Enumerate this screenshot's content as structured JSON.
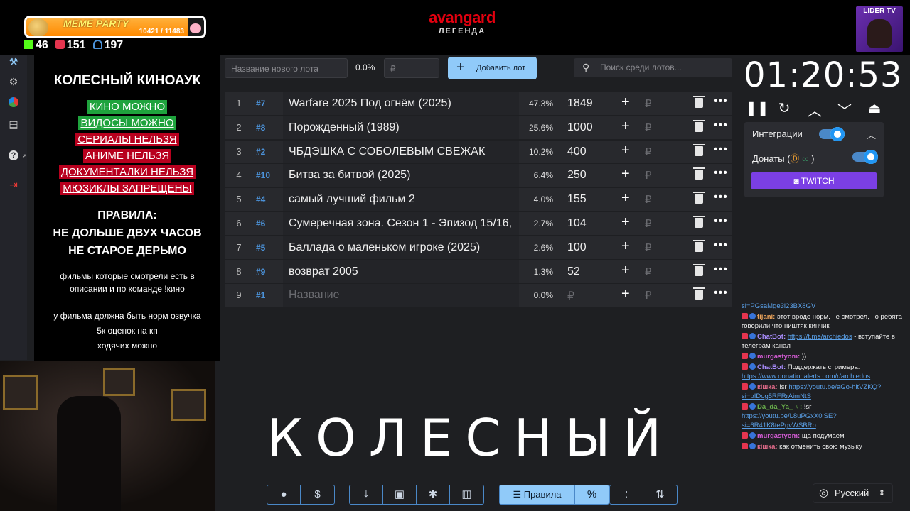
{
  "stream": {
    "meme_title": "MEME PARTY",
    "meme_count": "10421 / 11483",
    "meme_progress": 0.907,
    "stat_kick": "46",
    "stat_live": "151",
    "stat_viewers": "197",
    "brand_top": "avangard",
    "brand_bottom": "ЛЕГЕНДА",
    "lider_label": "LIDER TV"
  },
  "info": {
    "title": "КОЛЕСНЫЙ КИНОАУК",
    "allowed": [
      "КИНО МОЖНО",
      "ВИДОСЫ МОЖНО"
    ],
    "forbidden": [
      "СЕРИАЛЫ НЕЛЬЗЯ",
      "АНИМЕ НЕЛЬЗЯ",
      "ДОКУМЕНТАЛКИ НЕЛЬЗЯ",
      "МЮЗИКЛЫ ЗАПРЕЩЕНЫ"
    ],
    "rules_title": "ПРАВИЛА:",
    "rule1": "НЕ ДОЛЬШЕ ДВУХ ЧАСОВ",
    "rule2": "НЕ СТАРОЕ ДЕРЬМО",
    "note1": "фильмы которые смотрели есть в описании и по команде !кино",
    "note2": "у фильма должна быть норм озвучка",
    "note3": "5к оценок на кп",
    "note4": "ходячих можно"
  },
  "controls": {
    "new_lot_placeholder": "Название нового лота",
    "percent": "0.0%",
    "currency_placeholder": "₽",
    "add_lot": "Добавить лот",
    "search_placeholder": "Поиск среди лотов..."
  },
  "lots": [
    {
      "n": "1",
      "id": "#7",
      "name": "Warfare 2025 Под огнём (2025)",
      "pct": "47.3%",
      "amount": "1849"
    },
    {
      "n": "2",
      "id": "#8",
      "name": "Порожденный (1989)",
      "pct": "25.6%",
      "amount": "1000"
    },
    {
      "n": "3",
      "id": "#2",
      "name": "ЧБДЭШКА С СОБОЛЕВЫМ СВЕЖАК",
      "pct": "10.2%",
      "amount": "400"
    },
    {
      "n": "4",
      "id": "#10",
      "name": " Битва за битвой (2025)",
      "pct": "6.4%",
      "amount": "250"
    },
    {
      "n": "5",
      "id": "#4",
      "name": "самый лучший фильм 2",
      "pct": "4.0%",
      "amount": "155"
    },
    {
      "n": "6",
      "id": "#6",
      "name": "Сумеречная зона. Сезон 1 - Эпизод 15/16,",
      "pct": "2.7%",
      "amount": "104"
    },
    {
      "n": "7",
      "id": "#5",
      "name": "Баллада о маленьком игроке (2025)",
      "pct": "2.6%",
      "amount": "100"
    },
    {
      "n": "8",
      "id": "#9",
      "name": "возврат 2005",
      "pct": "1.3%",
      "amount": "52"
    },
    {
      "n": "9",
      "id": "#1",
      "name": "Название",
      "pct": "0.0%",
      "amount": "₽"
    }
  ],
  "big_word": "КОЛЕСНЫЙ",
  "timer": "01:20:53",
  "panel": {
    "integrations": "Интеграции",
    "donations_prefix": "Донаты (",
    "donations_suffix": ")",
    "twitch": "TWITCH"
  },
  "chat": [
    {
      "link": "si=PGsaMge3l23BX8GV"
    },
    {
      "user": "tijani:",
      "color": "#e9a25a",
      "text": " этот вроде норм, не смотрел, но ребята говорили что ништяк кинчик"
    },
    {
      "user": "ChatBot:",
      "color": "#a78bfa",
      "link": "https://t.me/archiedos",
      "text": " - вступайте в телеграм канал"
    },
    {
      "user": "murgastyom:",
      "color": "#d35bd3",
      "text": " ))"
    },
    {
      "user": "ChatBot:",
      "color": "#a78bfa",
      "text": " Поддержать стримера: ",
      "link": "https://www.donationalerts.com/r/archiedos"
    },
    {
      "user": "кiшка:",
      "color": "#e26b8a",
      "text": " !sr ",
      "link": "https://youtu.be/aGo-hitVZKQ?si=bIDog5RFRrAimNtS"
    },
    {
      "user": "Da_da_Ya_ ♀:",
      "color": "#6ab04c",
      "text": " !sr ",
      "link": "https://youtu.be/L8uPGxX0lSE?si=6R41K8tePgvWSBRb"
    },
    {
      "user": "murgastyom:",
      "color": "#d35bd3",
      "text": " ща подумаем"
    },
    {
      "user": "кiшка:",
      "color": "#e26b8a",
      "text": " как отменить свою музыку"
    }
  ],
  "toolbar": {
    "rules": "Правила",
    "language": "Русский"
  }
}
